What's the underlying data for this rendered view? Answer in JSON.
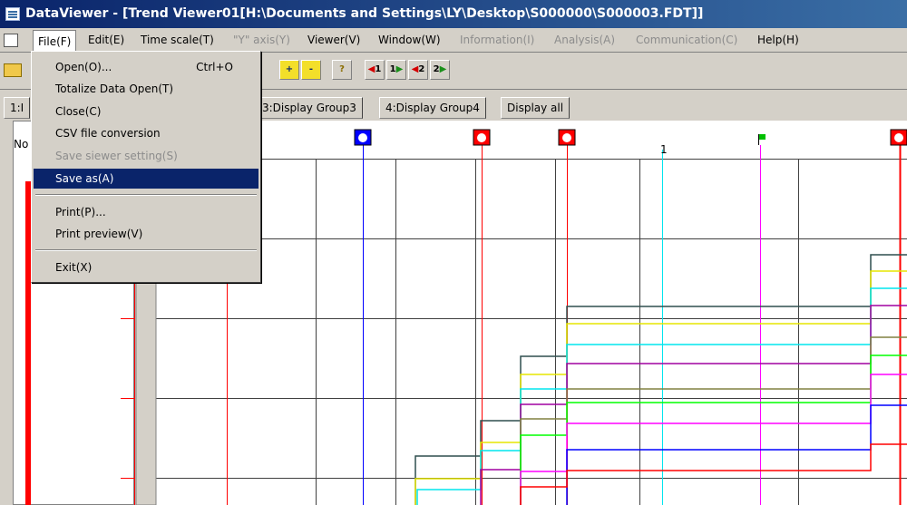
{
  "window": {
    "title": "DataViewer - [Trend Viewer01[H:\\Documents and Settings\\LY\\Desktop\\S000000\\S000003.FDT]]"
  },
  "menubar": {
    "items": [
      {
        "label": "File(F)",
        "enabled": true,
        "active": true
      },
      {
        "label": "Edit(E)",
        "enabled": true
      },
      {
        "label": "Time scale(T)",
        "enabled": true
      },
      {
        "label": "\"Y\" axis(Y)",
        "enabled": false
      },
      {
        "label": "Viewer(V)",
        "enabled": true
      },
      {
        "label": "Window(W)",
        "enabled": true
      },
      {
        "label": "Information(I)",
        "enabled": false
      },
      {
        "label": "Analysis(A)",
        "enabled": false
      },
      {
        "label": "Communication(C)",
        "enabled": false
      },
      {
        "label": "Help(H)",
        "enabled": true
      }
    ]
  },
  "file_menu": {
    "items": [
      {
        "label": "Open(O)...",
        "shortcut": "Ctrl+O",
        "enabled": true
      },
      {
        "label": "Totalize Data Open(T)",
        "enabled": true
      },
      {
        "label": "Close(C)",
        "enabled": true
      },
      {
        "label": "CSV file conversion",
        "enabled": true
      },
      {
        "label": "Save siewer setting(S)",
        "enabled": false
      },
      {
        "label": "Save as(A)",
        "enabled": true,
        "selected": true
      },
      {
        "label": "Print(P)...",
        "enabled": true
      },
      {
        "label": "Print preview(V)",
        "enabled": true
      },
      {
        "label": "Exit(X)",
        "enabled": true
      }
    ]
  },
  "toolbar": {
    "buttons": [
      {
        "icon": "open-folder-icon"
      },
      {
        "icon": "zoom-in-icon",
        "text": "+"
      },
      {
        "icon": "zoom-out-icon",
        "text": "-"
      },
      {
        "icon": "help-cursor-icon",
        "text": "?"
      },
      {
        "icon": "cursor1-left-icon",
        "text": "1"
      },
      {
        "icon": "cursor1-right-icon",
        "text": "1"
      },
      {
        "icon": "cursor2-left-icon",
        "text": "2"
      },
      {
        "icon": "cursor2-right-icon",
        "text": "2"
      }
    ]
  },
  "tabs": {
    "first_partial": "1:I",
    "items": [
      "3:Display Group3",
      "4:Display Group4",
      "Display all"
    ]
  },
  "chart": {
    "left_label": "No",
    "marker_text": "1",
    "colors": {
      "red": "#ff0000",
      "blue": "#0000ff",
      "cyan": "#00e5ee",
      "magenta": "#ff00ff",
      "green": "#00ff00",
      "yellow": "#ffff00",
      "darkslate": "#2f4f4f",
      "purple": "#800080"
    }
  }
}
